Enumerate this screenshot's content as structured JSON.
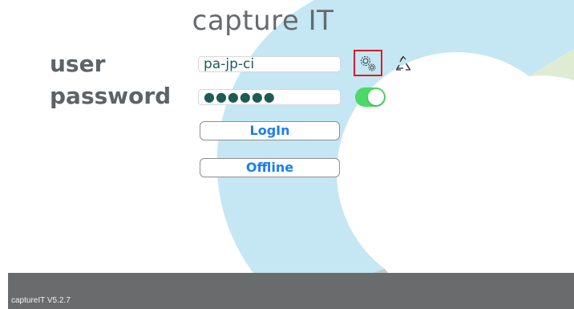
{
  "app": {
    "title": "capture IT",
    "version": "captureIT V5.2.7"
  },
  "form": {
    "user_label": "user",
    "password_label": "password",
    "user_value": "pa-jp-ci",
    "password_mask": "●●●●●●",
    "remember_toggle_on": true
  },
  "buttons": {
    "login_label": "LogIn",
    "offline_label": "Offline"
  },
  "icons": {
    "settings": "settings-gears-icon",
    "recycle": "recycle-icon"
  },
  "colors": {
    "accent_blue": "#1a7ff0",
    "toggle_on": "#4cd964",
    "highlight_border": "#d4202c",
    "footer_bg": "#696b6c",
    "ring_blue": "#c5e6f3",
    "ring_green": "#dfecd3"
  }
}
